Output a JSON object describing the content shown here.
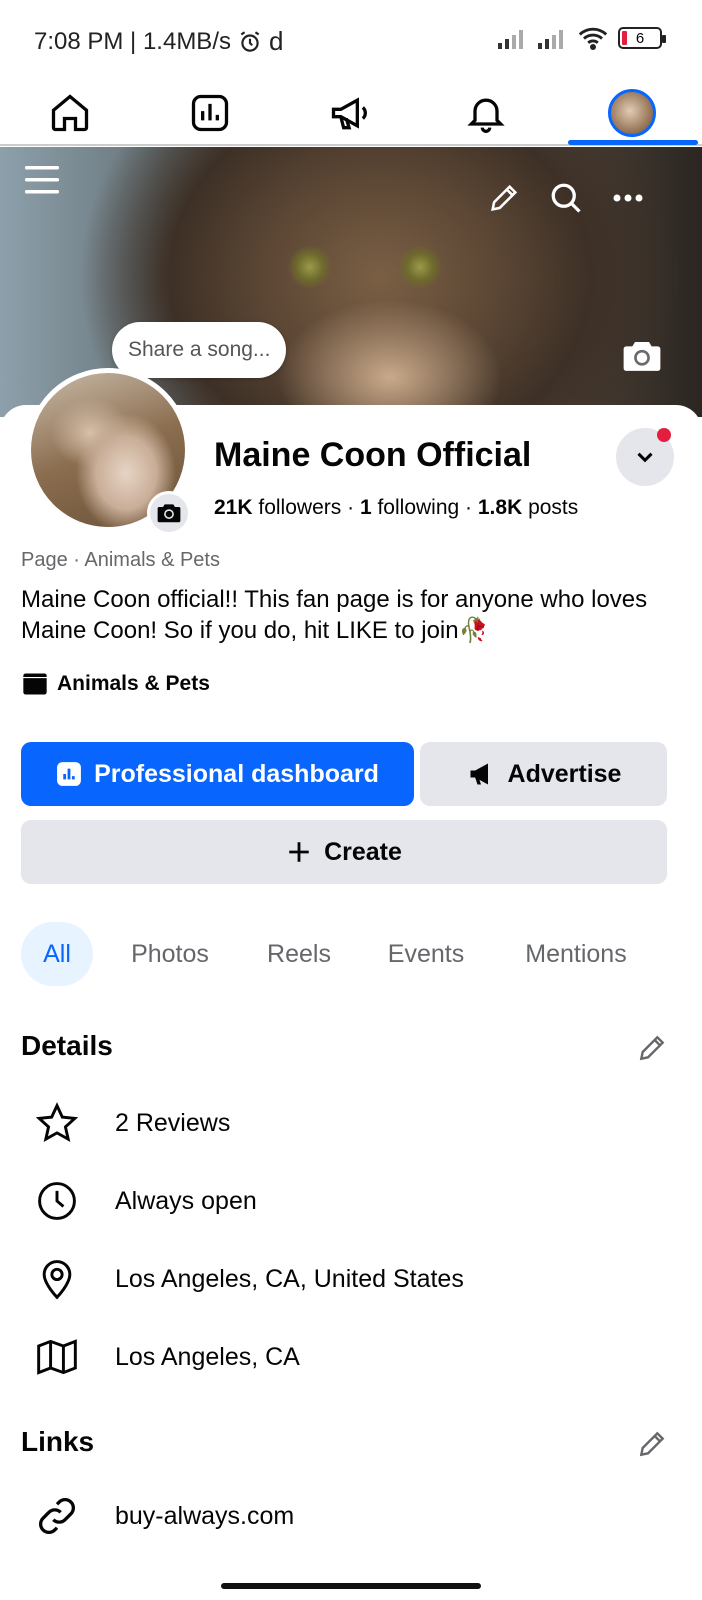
{
  "status_bar": {
    "time_info": "7:08 PM | 1.4MB/s",
    "extra": "d",
    "battery": "6"
  },
  "nav": {
    "items": [
      "home-icon",
      "dashboard-icon",
      "megaphone-icon",
      "bell-icon",
      "profile-avatar"
    ],
    "active": "profile-avatar",
    "accent": "#0866ff"
  },
  "cover": {
    "song_prompt": "Share a song..."
  },
  "profile": {
    "name": "Maine Coon Official",
    "followers_count": "21K",
    "followers_label": "followers",
    "following_count": "1",
    "following_label": "following",
    "posts_count": "1.8K",
    "posts_label": "posts",
    "separator": "·",
    "category_line": "Page · Animals & Pets",
    "bio": "Maine Coon official!! This fan page is for anyone who loves Maine Coon! So if you do, hit LIKE to join🥀",
    "category_chip": "Animals & Pets"
  },
  "actions": {
    "dashboard_label": "Professional dashboard",
    "advertise_label": "Advertise",
    "create_label": "Create"
  },
  "tabs": [
    {
      "label": "All",
      "active": true
    },
    {
      "label": "Photos",
      "active": false
    },
    {
      "label": "Reels",
      "active": false
    },
    {
      "label": "Events",
      "active": false
    },
    {
      "label": "Mentions",
      "active": false
    }
  ],
  "details": {
    "title": "Details",
    "items": [
      {
        "icon": "star-icon",
        "text": "2 Reviews"
      },
      {
        "icon": "clock-icon",
        "text": "Always open"
      },
      {
        "icon": "location-pin-icon",
        "text": "Los Angeles, CA, United States"
      },
      {
        "icon": "map-icon",
        "text": "Los Angeles, CA"
      }
    ]
  },
  "links": {
    "title": "Links",
    "items": [
      {
        "icon": "link-icon",
        "text": "buy-always.com"
      }
    ]
  },
  "colors": {
    "primary": "#0866ff",
    "secondary_bg": "#e4e6eb",
    "muted_text": "#65676b",
    "notification": "#e41e3f"
  }
}
